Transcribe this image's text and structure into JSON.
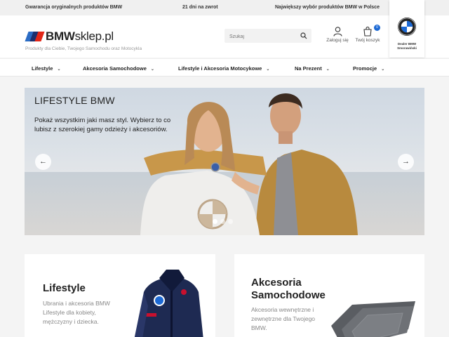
{
  "topbar": {
    "guarantee": "Gwarancja oryginalnych produktów BMW",
    "returns": "21 dni na zwrot",
    "selection": "Największy wybór produktów BMW w Polsce"
  },
  "header": {
    "logo_bold": "BMW",
    "logo_rest": "sklep.pl",
    "tagline": "Produkty dla Ciebie, Twojego Samochodu oraz Motocykla",
    "search_placeholder": "Szukaj",
    "login_label": "Zaloguj się",
    "cart_label": "Twój koszyk",
    "cart_count": "0",
    "dealer_line1": "Dealer BMW",
    "dealer_line2": "Smorawiński"
  },
  "nav": {
    "items": [
      {
        "label": "Lifestyle"
      },
      {
        "label": "Akcesoria Samochodowe"
      },
      {
        "label": "Lifestyle i Akcesoria Motocykowe"
      },
      {
        "label": "Na Prezent"
      },
      {
        "label": "Promocje"
      }
    ]
  },
  "hero": {
    "title": "LIFESTYLE BMW",
    "text": "Pokaż wszystkim jaki masz styl. Wybierz to co lubisz z szerokiej gamy odzieży i akcesoriów.",
    "prev_glyph": "←",
    "next_glyph": "→",
    "active_slide": 1,
    "slide_count": 3
  },
  "cards": [
    {
      "title": "Lifestyle",
      "text": "Ubrania i akcesoria BMW Lifestyle dla kobiety, mężczyzny i dziecka."
    },
    {
      "title": "Akcesoria Samochodowe",
      "text": "Akcesoria wewnętrzne i zewnętrzne dla Twojego BMW."
    }
  ],
  "colors": {
    "accent": "#1c69d4",
    "brand_red": "#e22718",
    "brand_dark_blue": "#1b2f6e"
  }
}
